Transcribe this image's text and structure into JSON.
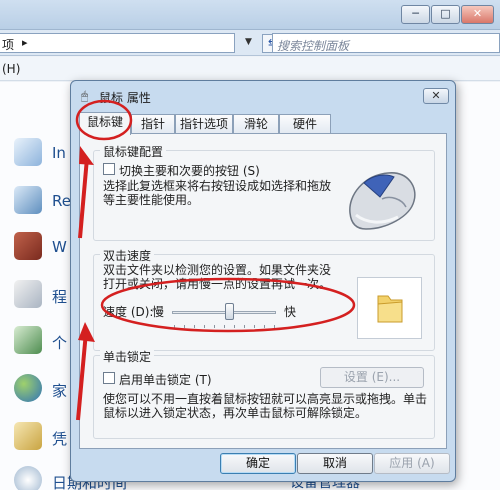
{
  "background_window": {
    "address_text": "项",
    "search_placeholder": "搜索控制面板",
    "menu_help": "(H)",
    "items": [
      {
        "label": "In"
      },
      {
        "label": "Re"
      },
      {
        "label": "W"
      },
      {
        "label": "程"
      },
      {
        "label": "个"
      },
      {
        "label": "家"
      },
      {
        "label": "凭"
      },
      {
        "label": "日期和时间"
      }
    ],
    "bottom_right_label": "设备管理器"
  },
  "dialog": {
    "title": "鼠标 属性",
    "tabs": [
      {
        "label": "鼠标键",
        "active": true
      },
      {
        "label": "指针",
        "active": false
      },
      {
        "label": "指针选项",
        "active": false
      },
      {
        "label": "滑轮",
        "active": false
      },
      {
        "label": "硬件",
        "active": false
      }
    ],
    "button_config": {
      "title": "鼠标键配置",
      "switch_label": "切换主要和次要的按钮 (S)",
      "switch_checked": false,
      "description_lines": [
        "选择此复选框来将右按钮设成如选择和拖放",
        "等主要性能使用。"
      ]
    },
    "double_click": {
      "title": "双击速度",
      "description_lines": [
        "双击文件夹以检测您的设置。如果文件夹没",
        "打开或关闭，请用慢一点的设置再试一次。"
      ],
      "speed_label": "速度 (D):",
      "slow_label": "慢",
      "fast_label": "快",
      "speed_value": 0.55
    },
    "click_lock": {
      "title": "单击锁定",
      "enable_label": "启用单击锁定 (T)",
      "enabled": false,
      "settings_label": "设置 (E)...",
      "description_lines": [
        "使您可以不用一直按着鼠标按钮就可以高亮显示或拖拽。单击",
        "鼠标以进入锁定状态，再次单击鼠标可解除锁定。"
      ]
    },
    "buttons": {
      "ok": "确定",
      "cancel": "取消",
      "apply": "应用 (A)"
    }
  },
  "colors": {
    "annotation": "#d42020",
    "link": "#1f4f8f"
  }
}
